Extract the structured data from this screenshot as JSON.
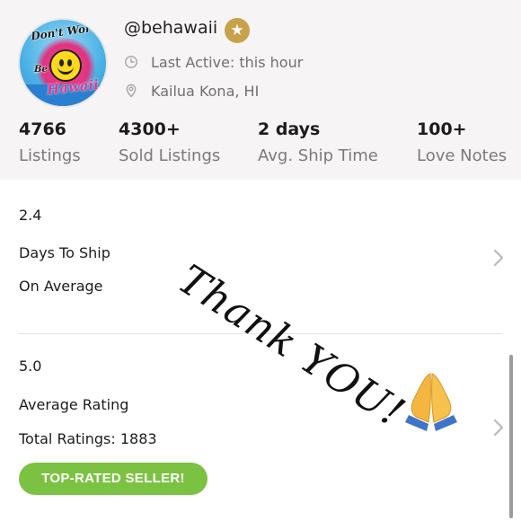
{
  "profile": {
    "username": "@behawaii",
    "avatar_text": [
      "Don't Worry",
      "Be",
      "Hawaii"
    ],
    "last_active": "Last Active: this hour",
    "location": "Kailua Kona, HI",
    "badge_icon": "star-icon",
    "badge_color": "#c8a24a"
  },
  "stats": [
    {
      "value": "4766",
      "label": "Listings"
    },
    {
      "value": "4300+",
      "label": "Sold Listings"
    },
    {
      "value": "2 days",
      "label": "Avg. Ship Time"
    },
    {
      "value": "100+",
      "label": "Love Notes"
    }
  ],
  "shipping": {
    "value": "2.4",
    "title": "Days To Ship",
    "subtitle": "On Average"
  },
  "rating": {
    "value": "5.0",
    "title": "Average Rating",
    "subtitle": "Total Ratings: 1883"
  },
  "badge": {
    "label": "TOP-RATED SELLER!",
    "color": "#7cc242"
  },
  "overlay": {
    "text": "Thank YOU!",
    "emoji_icon": "folded-hands-icon"
  },
  "colors": {
    "panel_bg": "#f6f4f4",
    "text_secondary": "#777777",
    "accent_green": "#7cc242"
  }
}
